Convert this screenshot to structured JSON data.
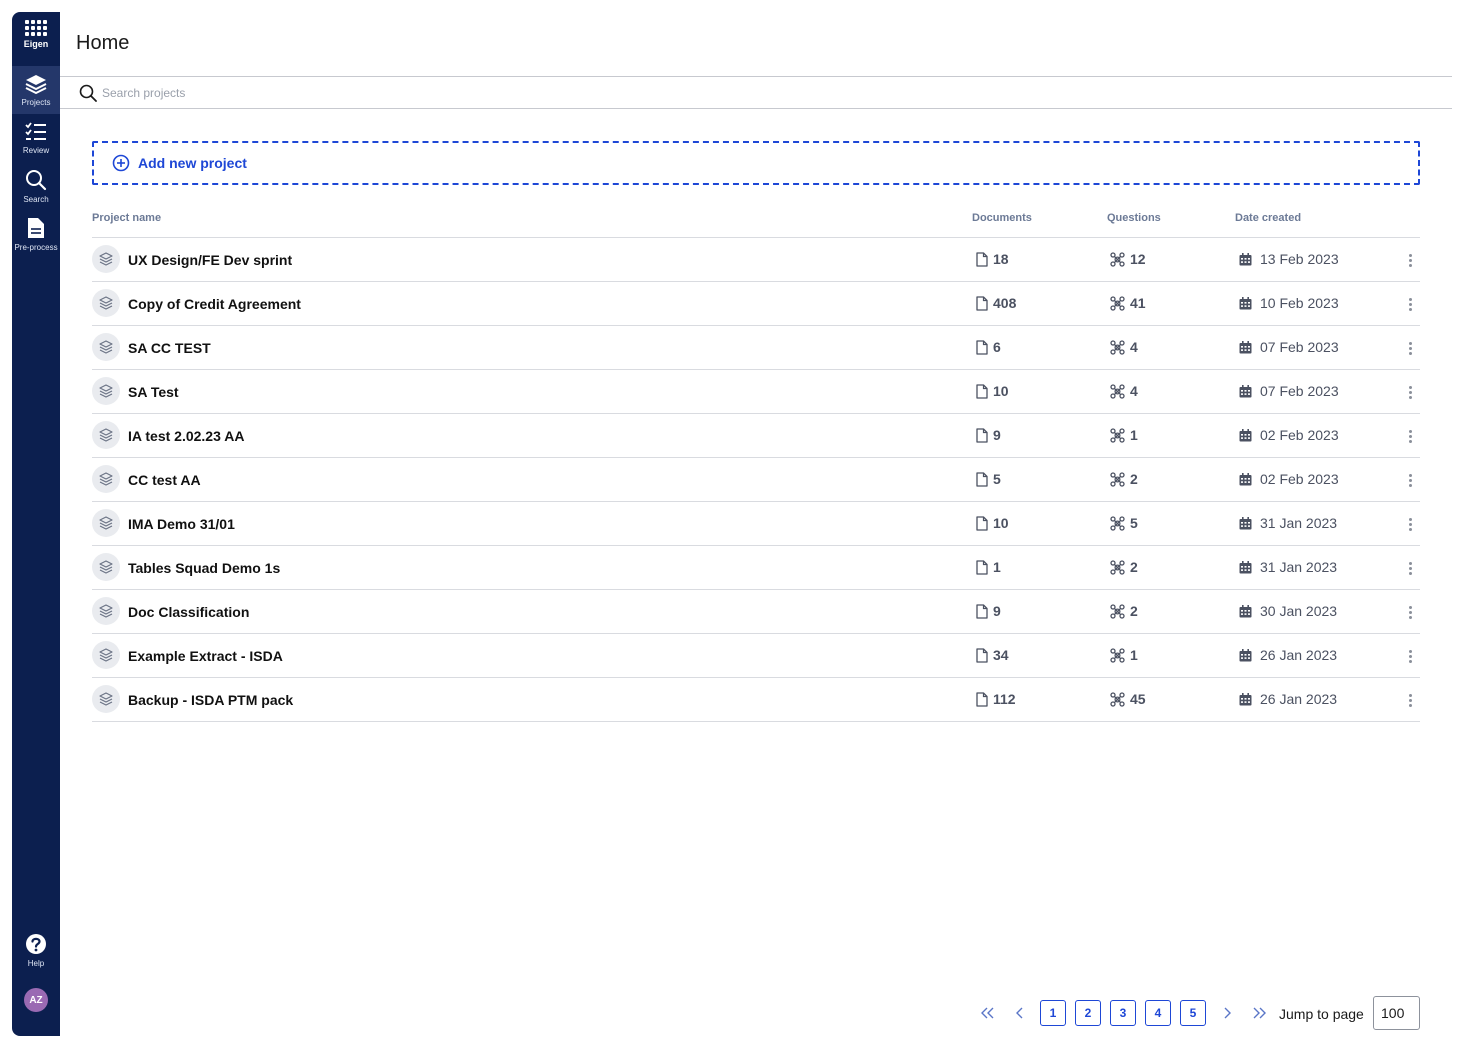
{
  "app": {
    "logo_text": "Eigen",
    "page_title": "Home",
    "accent_color": "#1e47d6",
    "sidebar_color": "#0c1f4f"
  },
  "sidebar": {
    "items": [
      {
        "label": "Projects",
        "icon": "layers-icon",
        "active": true
      },
      {
        "label": "Review",
        "icon": "checklist-icon",
        "active": false
      },
      {
        "label": "Search",
        "icon": "search-icon",
        "active": false
      },
      {
        "label": "Pre-process",
        "icon": "document-icon",
        "active": false
      }
    ],
    "help_label": "Help",
    "avatar_initials": "AZ"
  },
  "search": {
    "placeholder": "Search projects"
  },
  "add_project_label": "Add new project",
  "table": {
    "columns": {
      "name": "Project name",
      "documents": "Documents",
      "questions": "Questions",
      "date": "Date created"
    },
    "rows": [
      {
        "name": "UX Design/FE Dev sprint",
        "documents": "18",
        "questions": "12",
        "date": "13 Feb 2023"
      },
      {
        "name": "Copy of Credit Agreement",
        "documents": "408",
        "questions": "41",
        "date": "10 Feb 2023"
      },
      {
        "name": "SA CC TEST",
        "documents": "6",
        "questions": "4",
        "date": "07 Feb 2023"
      },
      {
        "name": "SA Test",
        "documents": "10",
        "questions": "4",
        "date": "07 Feb 2023"
      },
      {
        "name": "IA test 2.02.23 AA",
        "documents": "9",
        "questions": "1",
        "date": "02 Feb 2023"
      },
      {
        "name": "CC test AA",
        "documents": "5",
        "questions": "2",
        "date": "02 Feb 2023"
      },
      {
        "name": "IMA Demo 31/01",
        "documents": "10",
        "questions": "5",
        "date": "31 Jan 2023"
      },
      {
        "name": "Tables Squad Demo 1s",
        "documents": "1",
        "questions": "2",
        "date": "31 Jan 2023"
      },
      {
        "name": "Doc Classification",
        "documents": "9",
        "questions": "2",
        "date": "30 Jan 2023"
      },
      {
        "name": "Example Extract - ISDA",
        "documents": "34",
        "questions": "1",
        "date": "26 Jan 2023"
      },
      {
        "name": "Backup - ISDA PTM pack",
        "documents": "112",
        "questions": "45",
        "date": "26 Jan 2023"
      }
    ]
  },
  "pagination": {
    "pages": [
      "1",
      "2",
      "3",
      "4",
      "5"
    ],
    "jump_label": "Jump to page",
    "jump_value": "100"
  }
}
